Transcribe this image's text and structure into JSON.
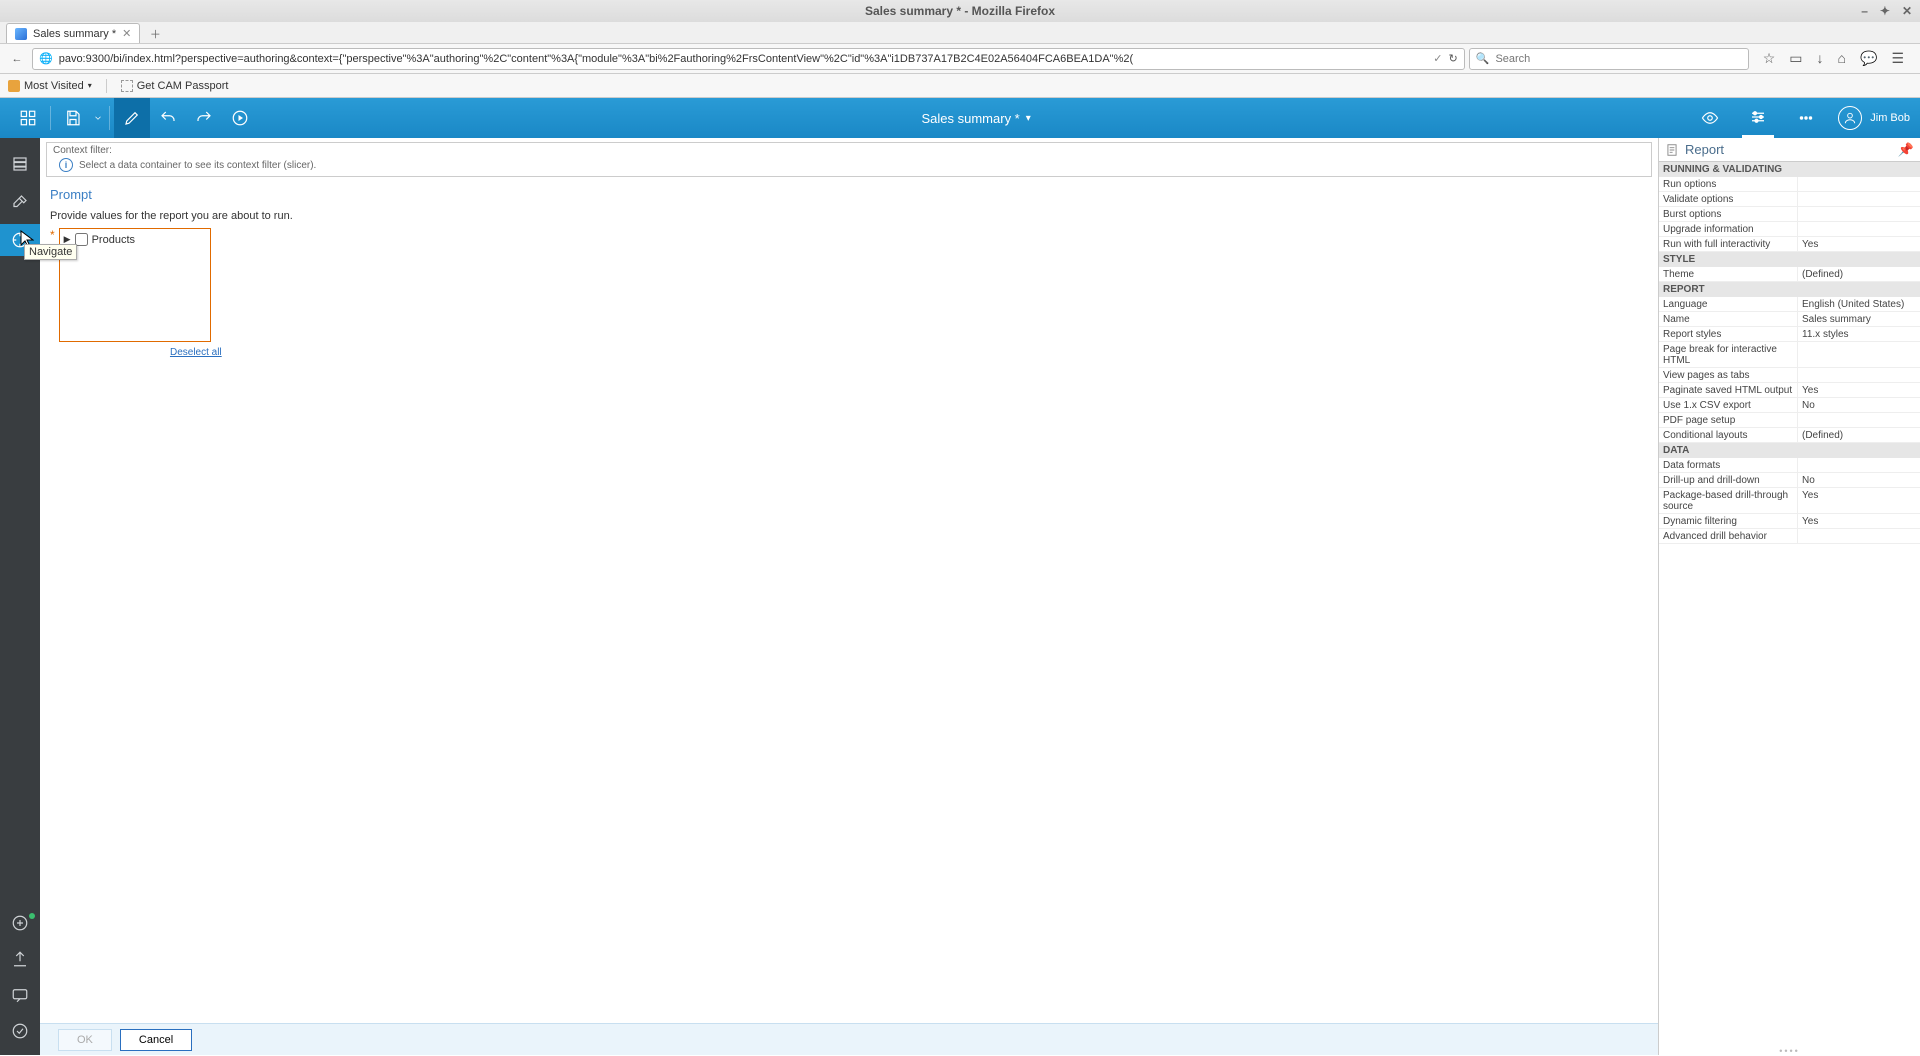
{
  "window": {
    "title": "Sales summary * - Mozilla Firefox",
    "tab_label": "Sales summary *"
  },
  "nav": {
    "url": "pavo:9300/bi/index.html?perspective=authoring&context={\"perspective\"%3A\"authoring\"%2C\"content\"%3A{\"module\"%3A\"bi%2Fauthoring%2FrsContentView\"%2C\"id\"%3A\"i1DB737A17B2C4E02A56404FCA6BEA1DA\"%2(",
    "search_placeholder": "Search"
  },
  "bookmarks": {
    "most_visited": "Most Visited",
    "get_cam": "Get CAM Passport"
  },
  "appbar": {
    "doc_title": "Sales summary *",
    "user_name": "Jim Bob"
  },
  "tooltip": "Navigate",
  "context_filter": {
    "label": "Context filter:",
    "message": "Select a data container to see its context filter (slicer)."
  },
  "prompt": {
    "title": "Prompt",
    "desc": "Provide values for the report you are about to run.",
    "tree_item": "Products",
    "deselect": "Deselect all"
  },
  "footer": {
    "ok": "OK",
    "cancel": "Cancel"
  },
  "right_panel": {
    "title": "Report",
    "sections": {
      "running": "RUNNING & VALIDATING",
      "style": "STYLE",
      "report": "REPORT",
      "data": "DATA"
    },
    "rows": {
      "run_options": "Run options",
      "validate_options": "Validate options",
      "burst_options": "Burst options",
      "upgrade_info": "Upgrade information",
      "run_full_interactivity": "Run with full interactivity",
      "run_full_interactivity_v": "Yes",
      "theme": "Theme",
      "theme_v": "(Defined)",
      "language": "Language",
      "language_v": "English (United States)",
      "name": "Name",
      "name_v": "Sales summary",
      "report_styles": "Report styles",
      "report_styles_v": "11.x styles",
      "page_break": "Page break for interactive HTML",
      "view_tabs": "View pages as tabs",
      "paginate": "Paginate saved HTML output",
      "paginate_v": "Yes",
      "csv": "Use 1.x CSV export",
      "csv_v": "No",
      "pdf": "PDF page setup",
      "cond_layouts": "Conditional layouts",
      "cond_layouts_v": "(Defined)",
      "data_formats": "Data formats",
      "drill_updown": "Drill-up and drill-down",
      "drill_updown_v": "No",
      "pkg_drill": "Package-based drill-through source",
      "pkg_drill_v": "Yes",
      "dyn_filter": "Dynamic filtering",
      "dyn_filter_v": "Yes",
      "adv_drill": "Advanced drill behavior"
    }
  }
}
